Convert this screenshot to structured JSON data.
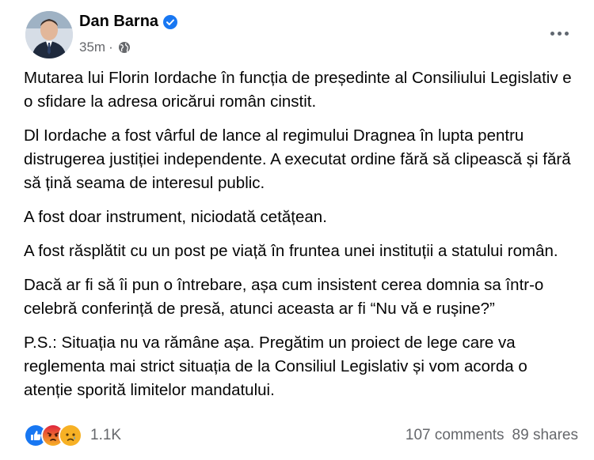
{
  "post": {
    "author": "Dan Barna",
    "time": "35m",
    "separator": "·",
    "icons": {
      "verified": "verified-badge-icon",
      "audience": "globe-icon",
      "menu": "more-options-icon"
    },
    "paragraphs": [
      "Mutarea lui Florin Iordache în funcția de președinte al Consiliului Legislativ e o sfidare la adresa oricărui român cinstit.",
      "Dl Iordache a fost vârful de lance al regimului Dragnea în lupta pentru distrugerea justiției independente. A executat ordine fără să clipească și fără să țină seama de interesul public.",
      "A fost doar instrument, niciodată cetățean.",
      "A fost răsplătit cu un post pe viață în fruntea unei instituții a statului român.",
      "Dacă ar fi să îi pun o întrebare, așa cum insistent cerea domnia sa într-o celebră conferință de presă, atunci aceasta ar fi “Nu vă e rușine?”",
      "P.S.: Situația nu va rămâne așa. Pregătim un proiect de lege care va reglementa mai strict situația de la Consiliul Legislativ și vom acorda o atenție sporită limitelor mandatului."
    ],
    "reactions": {
      "types": [
        "like",
        "angry",
        "sad"
      ],
      "count": "1.1K"
    },
    "comments": "107 comments",
    "shares": "89 shares",
    "colors": {
      "like": "#1877f2",
      "angry": "#e9710f",
      "sad": "#f7b125",
      "secondary_text": "#65676b"
    }
  }
}
